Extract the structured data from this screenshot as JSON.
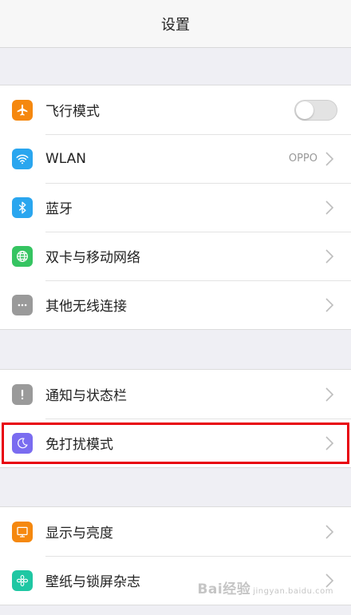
{
  "header": {
    "title": "设置"
  },
  "group1": {
    "items": [
      {
        "label": "飞行模式",
        "icon": "airplane-icon",
        "icon_color": "#f5880f",
        "control": "toggle",
        "toggle_on": false
      },
      {
        "label": "WLAN",
        "value": "OPPO",
        "icon": "wifi-icon",
        "icon_color": "#2aa6ef",
        "control": "chevron"
      },
      {
        "label": "蓝牙",
        "icon": "bluetooth-icon",
        "icon_color": "#2aa6ef",
        "control": "chevron"
      },
      {
        "label": "双卡与移动网络",
        "icon": "globe-icon",
        "icon_color": "#35c461",
        "control": "chevron"
      },
      {
        "label": "其他无线连接",
        "icon": "more-icon",
        "icon_color": "#9a9a9a",
        "control": "chevron"
      }
    ]
  },
  "group2": {
    "items": [
      {
        "label": "通知与状态栏",
        "icon": "exclamation-icon",
        "icon_color": "#9a9a9a",
        "control": "chevron"
      },
      {
        "label": "免打扰模式",
        "icon": "moon-icon",
        "icon_color": "#7a6cf0",
        "control": "chevron",
        "highlighted": true
      }
    ]
  },
  "group3": {
    "items": [
      {
        "label": "显示与亮度",
        "icon": "display-icon",
        "icon_color": "#f5880f",
        "control": "chevron"
      },
      {
        "label": "壁纸与锁屏杂志",
        "icon": "flower-icon",
        "icon_color": "#1fc7a3",
        "control": "chevron"
      }
    ]
  },
  "watermark": {
    "text": "Bai",
    "text2": "经验",
    "sub": "jingyan.baidu.com"
  },
  "colors": {
    "highlight_box": "#e8000b",
    "background": "#efeff4"
  }
}
